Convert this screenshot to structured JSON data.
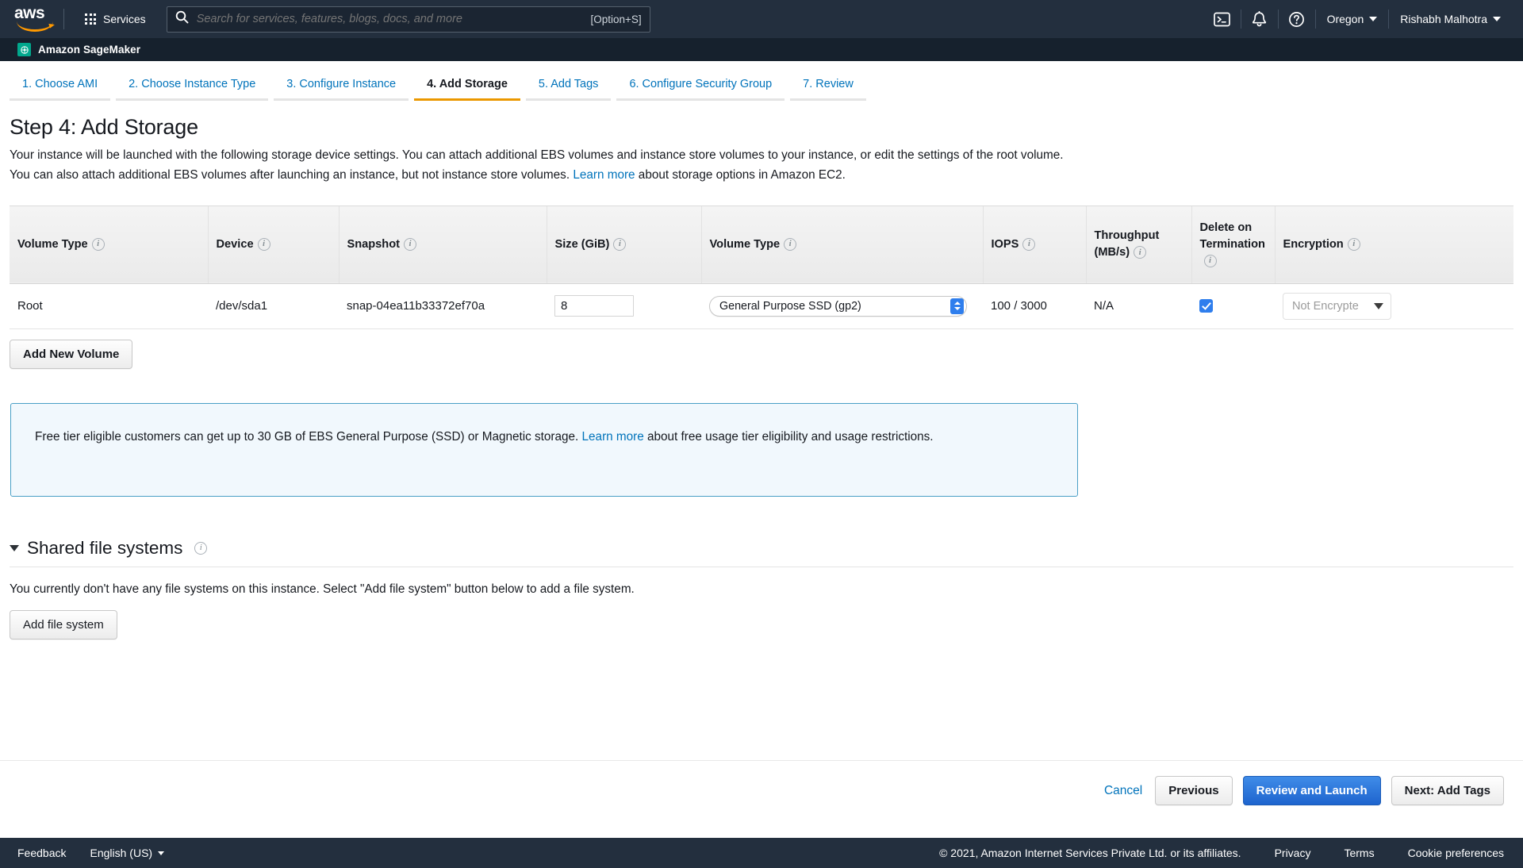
{
  "nav": {
    "logo_text": "aws",
    "services_label": "Services",
    "search_placeholder": "Search for services, features, blogs, docs, and more",
    "search_value": "",
    "search_shortcut": "[Option+S]",
    "cloudshell_icon": "cloudshell-icon",
    "bell_icon": "notifications-bell-icon",
    "help_icon": "help-question-icon",
    "region": "Oregon",
    "account": "Rishabh Malhotra"
  },
  "service_bar": {
    "service_name": "Amazon SageMaker",
    "service_icon": "sagemaker-icon"
  },
  "wizard": {
    "tabs": [
      {
        "label": "1. Choose AMI",
        "active": false
      },
      {
        "label": "2. Choose Instance Type",
        "active": false
      },
      {
        "label": "3. Configure Instance",
        "active": false
      },
      {
        "label": "4. Add Storage",
        "active": true
      },
      {
        "label": "5. Add Tags",
        "active": false
      },
      {
        "label": "6. Configure Security Group",
        "active": false
      },
      {
        "label": "7. Review",
        "active": false
      }
    ]
  },
  "page": {
    "title": "Step 4: Add Storage",
    "desc_part1": "Your instance will be launched with the following storage device settings. You can attach additional EBS volumes and instance store volumes to your instance, or edit the settings of the root volume. You can also attach additional EBS volumes after launching an instance, but not instance store volumes. ",
    "desc_link": "Learn more",
    "desc_part2": " about storage options in Amazon EC2."
  },
  "table": {
    "headers": [
      "Volume Type",
      "Device",
      "Snapshot",
      "Size (GiB)",
      "Volume Type",
      "IOPS",
      "Throughput (MB/s)",
      "Delete on Termination",
      "Encryption"
    ],
    "header_throughput_line1": "Throughput",
    "header_throughput_line2": "(MB/s)",
    "header_delete_line1": "Delete on",
    "header_delete_line2": "Termination",
    "row": {
      "volume_type": "Root",
      "device": "/dev/sda1",
      "snapshot": "snap-04ea11b33372ef70a",
      "size_value": "8",
      "volume_type_select": "General Purpose SSD (gp2)",
      "iops": "100 / 3000",
      "throughput": "N/A",
      "delete_on_termination_checked": true,
      "encryption": "Not Encrypte"
    }
  },
  "buttons": {
    "add_new_volume": "Add New Volume",
    "add_file_system": "Add file system",
    "cancel": "Cancel",
    "previous": "Previous",
    "review_and_launch": "Review and Launch",
    "next_add_tags": "Next: Add Tags"
  },
  "callout": {
    "text_part1": "Free tier eligible customers can get up to 30 GB of EBS General Purpose (SSD) or Magnetic storage. ",
    "link": "Learn more",
    "text_part2": " about free usage tier eligibility and usage restrictions."
  },
  "shared_file_systems": {
    "title": "Shared file systems",
    "empty_text": "You currently don't have any file systems on this instance. Select \"Add file system\" button below to add a file system."
  },
  "bottom_bar": {
    "feedback": "Feedback",
    "language": "English (US)",
    "copyright": "© 2021, Amazon Internet Services Private Ltd. or its affiliates.",
    "privacy": "Privacy",
    "terms": "Terms",
    "cookie_preferences": "Cookie preferences"
  },
  "colors": {
    "nav_bg": "#232f3e",
    "service_bar_bg": "#16212d",
    "accent_orange": "#eb9800",
    "link_blue": "#0073bb",
    "primary_button": "#2176d2",
    "sagemaker_green": "#01a88d",
    "callout_bg": "#f1f8fd",
    "callout_border": "#4aa0c6"
  }
}
